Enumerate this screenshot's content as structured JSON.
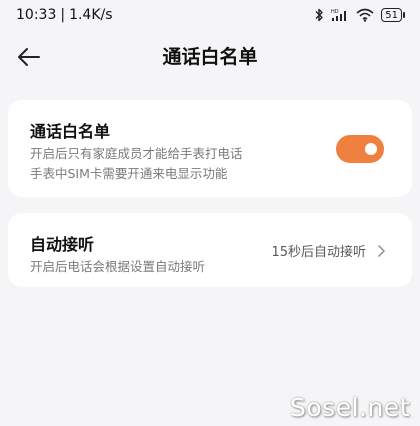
{
  "status_bar": {
    "time": "10:33",
    "separator": "|",
    "net_speed": "1.4K/s",
    "battery_level": "51",
    "icons": [
      "bluetooth-icon",
      "hd-signal-icon",
      "wifi-icon",
      "battery-icon"
    ]
  },
  "header": {
    "title": "通话白名单",
    "back_icon": "arrow-left-icon"
  },
  "whitelist_card": {
    "title": "通话白名单",
    "desc_line1": "开启后只有家庭成员才能给手表打电话",
    "desc_line2": "手表中SIM卡需要开通来电显示功能",
    "toggle_on": true,
    "toggle_color": "#f08040"
  },
  "auto_answer_card": {
    "title": "自动接听",
    "desc": "开启后电话会根据设置自动接听",
    "value": "15秒后自动接听",
    "chevron_icon": "chevron-right-icon"
  },
  "watermark": "Sosel.net"
}
